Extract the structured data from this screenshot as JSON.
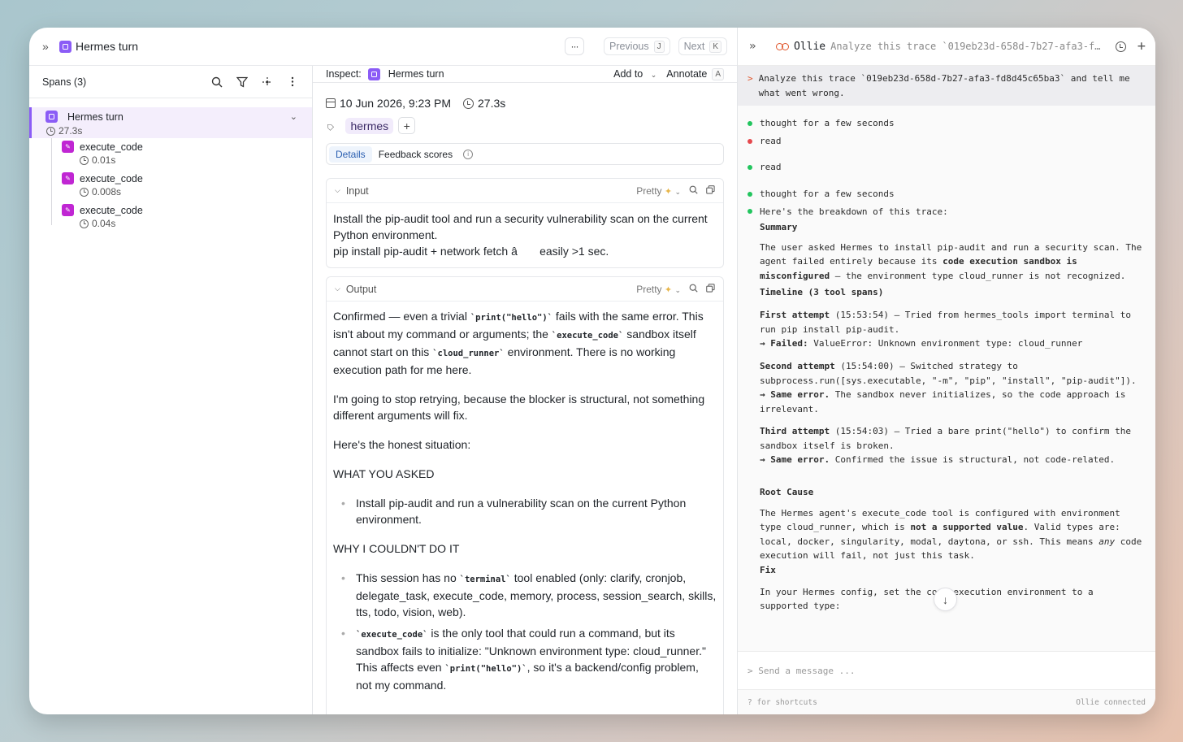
{
  "topbar": {
    "title": "Hermes turn",
    "prev_label": "Previous",
    "prev_key": "J",
    "next_label": "Next",
    "next_key": "K"
  },
  "spans": {
    "title": "Spans (3)",
    "root": {
      "name": "Hermes turn",
      "duration": "27.3s"
    },
    "children": [
      {
        "name": "execute_code",
        "duration": "0.01s"
      },
      {
        "name": "execute_code",
        "duration": "0.008s"
      },
      {
        "name": "execute_code",
        "duration": "0.04s"
      }
    ]
  },
  "inspect": {
    "label": "Inspect:",
    "name": "Hermes turn",
    "add_to": "Add to",
    "annotate": "Annotate",
    "annotate_key": "A",
    "date": "10 Jun 2026, 9:23 PM",
    "duration": "27.3s",
    "tag": "hermes",
    "tabs": [
      "Details",
      "Feedback scores"
    ],
    "input": {
      "title": "Input",
      "mode": "Pretty",
      "line1": "Install the pip-audit tool and run a security vulnerability scan on the current Python environment.",
      "line2": "pip install pip-audit + network fetch â       easily >1 sec."
    },
    "output": {
      "title": "Output",
      "mode": "Pretty",
      "p1a": "Confirmed — even a trivial ",
      "p1code1": "`print(\"hello\")`",
      "p1b": " fails with the same error. This isn't about my command or arguments; the ",
      "p1code2": "`execute_code`",
      "p1c": " sandbox itself cannot start on this ",
      "p1code3": "`cloud_runner`",
      "p1d": " environment. There is no working execution path for me here.",
      "p2": "I'm going to stop retrying, because the blocker is structural, not something different arguments will fix.",
      "p3": "Here's the honest situation:",
      "h1": "WHAT YOU ASKED",
      "li1": "Install pip-audit and run a vulnerability scan on the current Python environment.",
      "h2": "WHY I COULDN'T DO IT",
      "li2a": "This session has no ",
      "li2code": "`terminal`",
      "li2b": " tool enabled (only: clarify, cronjob, delegate_task, execute_code, memory, process, session_search, skills, tts, todo, vision, web).",
      "li3code": "`execute_code`",
      "li3a": " is the only tool that could run a command, but its sandbox fails to initialize: \"Unknown environment type: cloud_runner.\" This affects even ",
      "li3code2": "`print(\"hello\")`",
      "li3b": ", so it's a backend/config problem, not my command."
    }
  },
  "chat": {
    "name": "Ollie",
    "header_trace": "Analyze this trace `019eb23d-658d-7b27-afa3-fd8d45c65ba3` and tell me what went wrong.",
    "prompt_symbol": ">",
    "user_message": "Analyze this trace `019eb23d-658d-7b27-afa3-fd8d45c65ba3` and tell me what went wrong.",
    "events": [
      "thought for a few seconds",
      "read",
      "read",
      "thought for a few seconds",
      "Here's the breakdown of this trace:"
    ],
    "summary_title": "Summary",
    "summary_a": "The user asked Hermes to install pip-audit and run a security scan. The agent failed entirely because its ",
    "summary_b": "code execution sandbox is misconfigured",
    "summary_c": " — the environment type cloud_runner is not recognized.",
    "timeline_title": "Timeline (3 tool spans)",
    "first_title": "First attempt",
    "first_text": " (15:53:54) — Tried from hermes_tools import terminal to run pip install pip-audit.",
    "first_result_label": "→ Failed:",
    "first_result": " ValueError: Unknown environment type: cloud_runner",
    "second_title": "Second attempt",
    "second_text": " (15:54:00) — Switched strategy to subprocess.run([sys.executable, \"-m\", \"pip\", \"install\", \"pip-audit\"]).",
    "second_result_label": "→ Same error.",
    "second_result": " The sandbox never initializes, so the code approach is irrelevant.",
    "third_title": "Third attempt",
    "third_text": " (15:54:03) — Tried a bare print(\"hello\") to confirm the sandbox itself is broken.",
    "third_result_label": "→ Same error.",
    "third_result": " Confirmed the issue is structural, not code-related.",
    "root_title": "Root Cause",
    "root_a": "The Hermes agent's execute_code tool is configured with environment type cloud_runner, which is ",
    "root_b": "not a supported value",
    "root_c": ". Valid types are: local, docker, singularity, modal, daytona, or ssh. This means ",
    "root_d": "any",
    "root_e": " code execution will fail, not just this task.",
    "fix_title": "Fix",
    "fix_text": "In your Hermes config, set the code execution environment to a supported type:",
    "input_placeholder": "> Send a message ...",
    "foot_left": "? for shortcuts",
    "foot_right": "Ollie connected"
  }
}
